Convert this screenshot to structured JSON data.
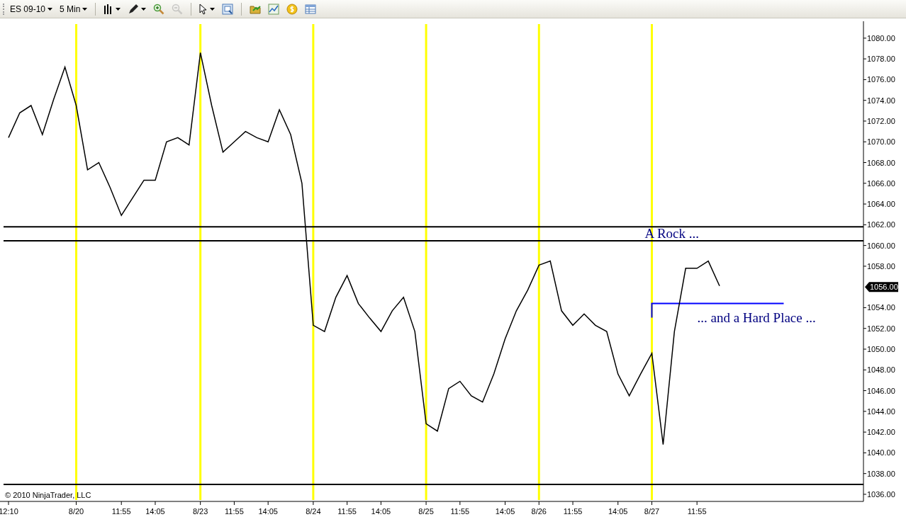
{
  "toolbar": {
    "items": [
      {
        "kind": "dropdown",
        "label": "ES 09-10",
        "disabled": false
      },
      {
        "kind": "dropdown",
        "label": "5 Min",
        "disabled": false
      },
      {
        "kind": "separator"
      },
      {
        "kind": "bars",
        "disabled": false,
        "caret": true
      },
      {
        "kind": "pencil",
        "disabled": false,
        "caret": true
      },
      {
        "kind": "zoom-in",
        "disabled": false
      },
      {
        "kind": "zoom-out",
        "disabled": true
      },
      {
        "kind": "separator"
      },
      {
        "kind": "cursor",
        "disabled": false,
        "caret": true
      },
      {
        "kind": "properties",
        "disabled": false
      },
      {
        "kind": "separator"
      },
      {
        "kind": "folder",
        "disabled": false
      },
      {
        "kind": "chart",
        "disabled": false
      },
      {
        "kind": "coin",
        "disabled": false
      },
      {
        "kind": "table",
        "disabled": false
      }
    ]
  },
  "chart": {
    "copyright": "© 2010 NinjaTrader, LLC",
    "last_price": "1056.00",
    "chart_data": {
      "type": "line",
      "ylim": [
        1035.45,
        1081.63
      ],
      "categories": [
        "12:10",
        null,
        null,
        null,
        null,
        null,
        "8/20",
        null,
        null,
        null,
        "11:55",
        null,
        null,
        "14:05",
        null,
        null,
        null,
        "8/23",
        null,
        null,
        "11:55",
        null,
        null,
        "14:05",
        null,
        null,
        null,
        "8/24",
        null,
        null,
        "11:55",
        null,
        null,
        "14:05",
        null,
        null,
        null,
        "8/25",
        null,
        null,
        "11:55",
        null,
        null,
        null,
        "14:05",
        null,
        null,
        "8/26",
        null,
        null,
        "11:55",
        null,
        null,
        null,
        "14:05",
        null,
        null,
        "8/27",
        null,
        null,
        null,
        "11:55",
        null,
        null
      ],
      "grid": false,
      "series": [
        {
          "color": "#000000",
          "values": [
            1070.4,
            1072.8,
            1073.5,
            1070.7,
            1074.1,
            1077.2,
            1073.5,
            1067.3,
            1068,
            1065.6,
            1062.9,
            1064.6,
            1066.3,
            1066.3,
            1070,
            1070.4,
            1069.7,
            1078.6,
            1073.5,
            1069,
            1070,
            1071,
            1070.4,
            1070,
            1073.1,
            1070.7,
            1066,
            1052.3,
            1051.7,
            1055,
            1057.1,
            1054.4,
            1053,
            1051.7,
            1053.7,
            1055,
            1051.7,
            1042.8,
            1042.1,
            1046.2,
            1046.9,
            1045.5,
            1044.9,
            1047.6,
            1051,
            1053.7,
            1055.7,
            1058.1,
            1058.5,
            1053.7,
            1052.3,
            1053.4,
            1052.3,
            1051.7,
            1047.6,
            1045.5,
            1047.6,
            1049.6,
            1040.8,
            1051.7,
            1057.8,
            1057.8,
            1058.5,
            1056.1
          ]
        }
      ],
      "yticks": [
        {
          "value": 1036,
          "label": "1036.00"
        },
        {
          "value": 1038,
          "label": "1038.00"
        },
        {
          "value": 1040,
          "label": "1040.00"
        },
        {
          "value": 1042,
          "label": "1042.00"
        },
        {
          "value": 1044,
          "label": "1044.00"
        },
        {
          "value": 1046,
          "label": "1046.00"
        },
        {
          "value": 1048,
          "label": "1048.00"
        },
        {
          "value": 1050,
          "label": "1050.00"
        },
        {
          "value": 1052,
          "label": "1052.00"
        },
        {
          "value": 1054,
          "label": "1054.00"
        },
        {
          "value": 1058,
          "label": "1058.00"
        },
        {
          "value": 1060,
          "label": "1060.00"
        },
        {
          "value": 1062,
          "label": "1062.00"
        },
        {
          "value": 1064,
          "label": "1064.00"
        },
        {
          "value": 1066,
          "label": "1066.00"
        },
        {
          "value": 1068,
          "label": "1068.00"
        },
        {
          "value": 1070,
          "label": "1070.00"
        },
        {
          "value": 1072,
          "label": "1072.00"
        },
        {
          "value": 1074,
          "label": "1074.00"
        },
        {
          "value": 1076,
          "label": "1076.00"
        },
        {
          "value": 1078,
          "label": "1078.00"
        },
        {
          "value": 1080,
          "label": "1080.00"
        }
      ],
      "ref_lines": [
        {
          "axis": "x",
          "value": "8/20"
        },
        {
          "axis": "x",
          "value": "8/23"
        },
        {
          "axis": "x",
          "value": "8/24"
        },
        {
          "axis": "x",
          "value": "8/25"
        },
        {
          "axis": "x",
          "value": "8/26"
        },
        {
          "axis": "x",
          "value": "8/27"
        },
        {
          "axis": "y",
          "value": 1061.8
        },
        {
          "axis": "y",
          "value": 1060.45
        },
        {
          "axis": "y",
          "value": 1036.95
        },
        {
          "axis": "y",
          "value": 1054.4
        }
      ],
      "annotations": [
        "A Rock ...",
        "... and a Hard Place ..."
      ]
    }
  }
}
